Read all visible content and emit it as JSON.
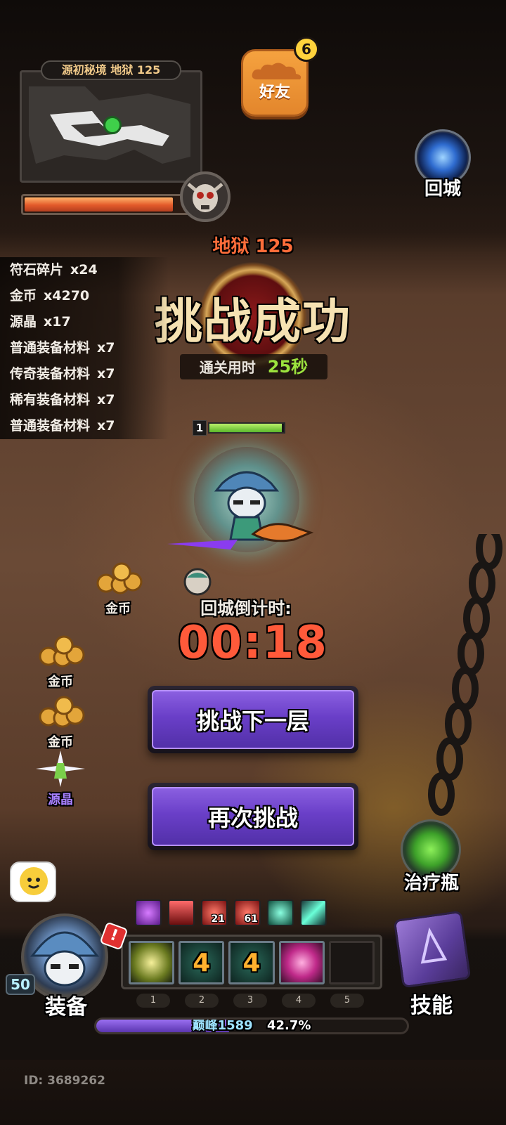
{
  "minimap": {
    "title": "源初秘境 地狱 125",
    "boss_hp_fraction": 0.92
  },
  "friends": {
    "label": "好友",
    "badge_count": "6"
  },
  "return_city": {
    "label": "回城"
  },
  "result": {
    "floor": "地狱 125",
    "title": "挑战成功",
    "clear_time_label": "通关用时",
    "clear_time_value": "25秒"
  },
  "loot": [
    {
      "name": "符石碎片",
      "count": "x24"
    },
    {
      "name": "金币",
      "count": "x4270"
    },
    {
      "name": "源晶",
      "count": "x17"
    },
    {
      "name": "普通装备材料",
      "count": "x7"
    },
    {
      "name": "传奇装备材料",
      "count": "x7"
    },
    {
      "name": "稀有装备材料",
      "count": "x7"
    },
    {
      "name": "普通装备材料",
      "count": "x7"
    }
  ],
  "hero": {
    "level": "1",
    "hp_fraction": 0.97
  },
  "drops": {
    "gold": "金币",
    "crystal": "源晶"
  },
  "countdown": {
    "label": "回城倒计时:",
    "time": "00:18"
  },
  "buttons": {
    "next": "挑战下一层",
    "retry": "再次挑战"
  },
  "potion": {
    "label": "治疗瓶"
  },
  "buffs": [
    {
      "icon": "purple-vortex-icon",
      "count": ""
    },
    {
      "icon": "red-pillar-icon",
      "count": ""
    },
    {
      "icon": "red-orb-icon",
      "count": "21"
    },
    {
      "icon": "red-orb-icon",
      "count": "61"
    },
    {
      "icon": "teal-swirl-icon",
      "count": ""
    },
    {
      "icon": "teal-shard-icon",
      "count": ""
    }
  ],
  "skills": {
    "slots": [
      {
        "icon": "wind-blade-icon",
        "text": ""
      },
      {
        "icon": "rune-four-icon",
        "text": "4"
      },
      {
        "icon": "rune-four-icon",
        "text": "4"
      },
      {
        "icon": "pink-sword-icon",
        "text": ""
      },
      {
        "icon": "empty-slot-icon",
        "text": ""
      }
    ],
    "numbers": [
      "1",
      "2",
      "3",
      "4",
      "5"
    ]
  },
  "player": {
    "level": "50",
    "equip_label": "装备",
    "equip_alert": "!",
    "skill_label": "技能",
    "peak_label": "巅峰",
    "peak_value": "1589",
    "exp_percent": "42.7%",
    "exp_fraction": 0.427,
    "id_text": "ID: 3689262"
  },
  "colors": {
    "accent_orange": "#ff6d3a",
    "time_green": "#9ce33e",
    "countdown_red": "#ff5a3a",
    "button_purple": "#6a3fc8"
  }
}
